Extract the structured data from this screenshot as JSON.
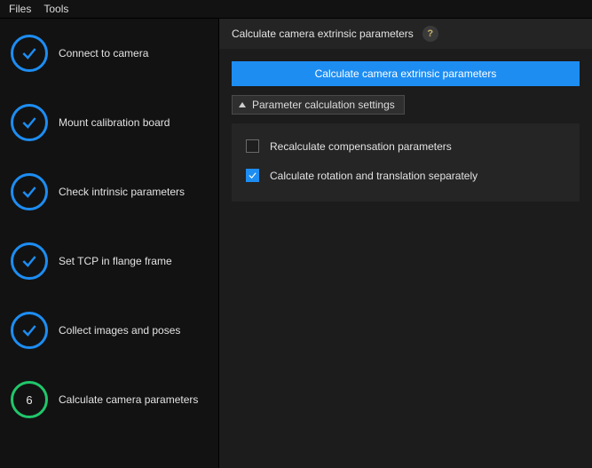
{
  "menubar": {
    "files": "Files",
    "tools": "Tools"
  },
  "steps": [
    {
      "label": "Connect to camera",
      "state": "done"
    },
    {
      "label": "Mount calibration board",
      "state": "done"
    },
    {
      "label": "Check intrinsic parameters",
      "state": "done"
    },
    {
      "label": "Set TCP in flange frame",
      "state": "done"
    },
    {
      "label": "Collect images and poses",
      "state": "done"
    },
    {
      "label": "Calculate camera parameters",
      "state": "current",
      "number": "6"
    }
  ],
  "header": {
    "title": "Calculate camera extrinsic parameters",
    "help_glyph": "?"
  },
  "actions": {
    "calculate_btn": "Calculate camera extrinsic parameters",
    "settings_toggle": "Parameter calculation settings"
  },
  "settings": {
    "recalc": {
      "label": "Recalculate compensation parameters",
      "checked": false
    },
    "sep": {
      "label": "Calculate rotation and translation separately",
      "checked": true
    }
  }
}
